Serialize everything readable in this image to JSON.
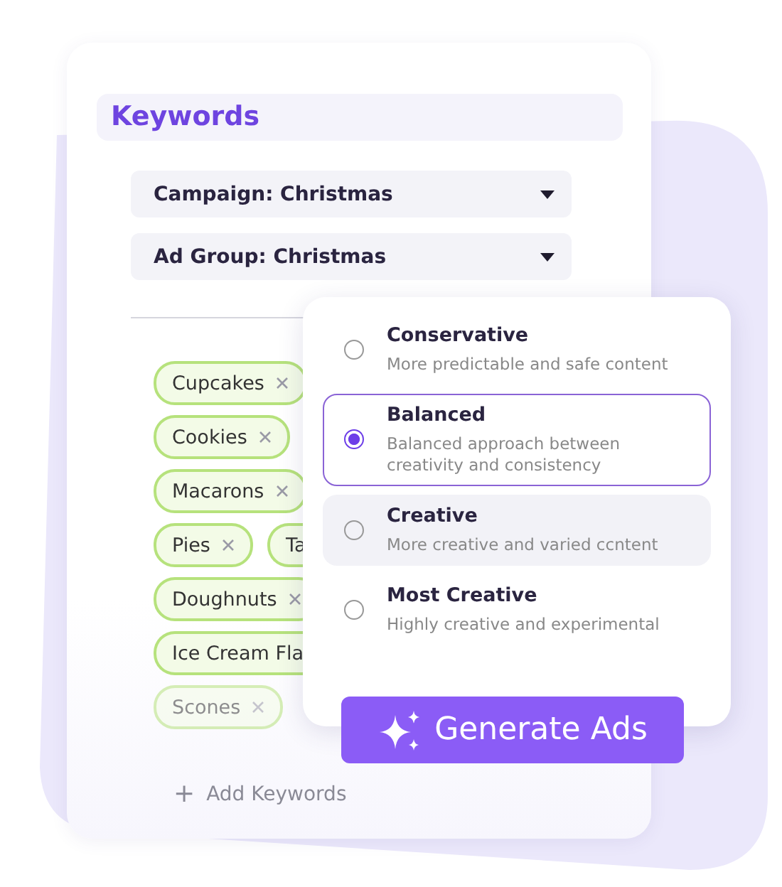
{
  "keywords_panel": {
    "title": "Keywords",
    "dropdowns": [
      {
        "label": "Campaign: Christmas"
      },
      {
        "label": "Ad Group: Christmas"
      }
    ],
    "chips": [
      {
        "label": "Cupcakes",
        "cut": false,
        "faded": false
      },
      {
        "label": "Cookies",
        "cut": false,
        "faded": false
      },
      {
        "label": "Macarons",
        "cut": false,
        "faded": false
      },
      {
        "label": "Pies",
        "cut": false,
        "faded": false
      },
      {
        "label": "Ta",
        "cut": true,
        "faded": false
      },
      {
        "label": "Doughnuts",
        "cut": false,
        "faded": false
      },
      {
        "label": "Ice Cream Fla",
        "cut": true,
        "faded": false
      },
      {
        "label": "Scones",
        "cut": false,
        "faded": true
      }
    ],
    "add_button": {
      "icon": "+",
      "label": "Add Keywords"
    }
  },
  "creativity_popover": {
    "options": [
      {
        "title": "Conservative",
        "description": "More predictable and safe content",
        "selected": false,
        "hovered": false
      },
      {
        "title": "Balanced",
        "description": "Balanced approach between creativity and consistency",
        "selected": true,
        "hovered": false
      },
      {
        "title": "Creative",
        "description": "More creative and varied ccntent",
        "selected": false,
        "hovered": true
      },
      {
        "title": "Most Creative",
        "description": "Highly creative and experimental",
        "selected": false,
        "hovered": false
      }
    ],
    "generate_button": {
      "label": "Generate Ads"
    }
  }
}
